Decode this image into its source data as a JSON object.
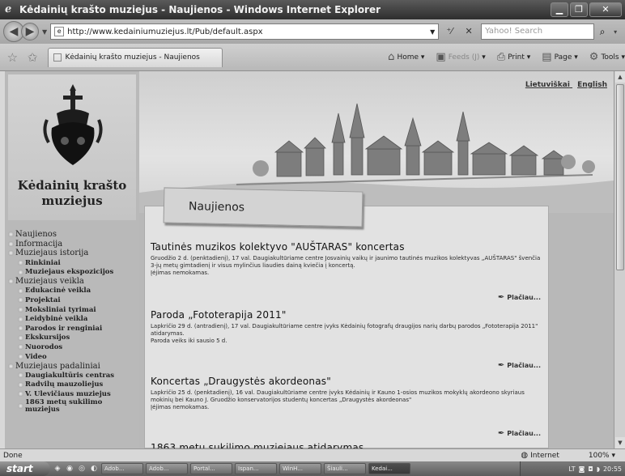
{
  "window": {
    "title": "Kėdainių krašto muziejus - Naujienos - Windows Internet Explorer"
  },
  "addressbar": {
    "url": "http://www.kedainiumuziejus.lt/Pub/default.aspx",
    "search_placeholder": "Yahoo! Search"
  },
  "commandbar": {
    "tab_title": "Kėdainių krašto muziejus - Naujienos",
    "home": "Home",
    "feeds": "Feeds (J)",
    "print": "Print",
    "page": "Page",
    "tools": "Tools"
  },
  "site": {
    "title": "Kėdainių krašto muziejus",
    "lang_lt": "Lietuviškai",
    "lang_en": "English",
    "section_heading": "Naujienos"
  },
  "menu": [
    {
      "label": "Naujienos",
      "sub": false
    },
    {
      "label": "Informacija",
      "sub": false
    },
    {
      "label": "Muziejaus istorija",
      "sub": false
    },
    {
      "label": "Rinkiniai",
      "sub": true
    },
    {
      "label": "Muziejaus ekspozicijos",
      "sub": true
    },
    {
      "label": "Muziejaus veikla",
      "sub": false
    },
    {
      "label": "Edukacinė veikla",
      "sub": true
    },
    {
      "label": "Projektai",
      "sub": true
    },
    {
      "label": "Moksliniai tyrimai",
      "sub": true
    },
    {
      "label": "Leidybinė veikla",
      "sub": true
    },
    {
      "label": "Parodos ir renginiai",
      "sub": true
    },
    {
      "label": "Ekskursijos",
      "sub": true
    },
    {
      "label": "Nuorodos",
      "sub": true
    },
    {
      "label": "Video",
      "sub": true
    },
    {
      "label": "Muziejaus padaliniai",
      "sub": false
    },
    {
      "label": "Daugiakultūris centras",
      "sub": true
    },
    {
      "label": "Radvilų mauzoliejus",
      "sub": true
    },
    {
      "label": "V. Ulevičiaus muziejus",
      "sub": true
    },
    {
      "label": "1863 metų sukilimo muziejus",
      "sub": true
    }
  ],
  "news": [
    {
      "title": "Tautinės muzikos kolektyvo \"AUŠTARAS\" koncertas",
      "body": "Gruodžio 2 d. (penktadienį), 17 val. Daugiakultūriame centre Josvainių vaikų ir jaunimo tautinės muzikos kolektyvas „AUŠTARAS\" švenčia 3-jų metų gimtadienį ir visus mylinčius liaudies dainą kviečia į koncertą.",
      "note": "Įėjimas nemokamas.",
      "more": "Plačiau..."
    },
    {
      "title": "Paroda „Fototerapija 2011\"",
      "body": "Lapkričio 29 d. (antradienį), 17 val. Daugiakultūriame centre įvyks Kėdainių fotografų draugijos narių darbų parodos „Fototerapija 2011\" atidarymas.",
      "note": "Paroda veiks iki sausio 5 d.",
      "more": "Plačiau..."
    },
    {
      "title": "Koncertas „Draugystės akordeonas\"",
      "body": "Lapkričio 25 d. (penktadienį), 16 val. Daugiakultūriame centre įvyks Kėdainių ir Kauno 1-osios muzikos mokyklų akordeono skyriaus mokinių bei Kauno J. Gruodžio konservatorijos studentų koncertas „Draugystės akordeonas\"",
      "note": "Įėjimas nemokamas.",
      "more": "Plačiau..."
    },
    {
      "title": "1863 metų sukilimo muziejaus atidarymas",
      "body": "",
      "note": "",
      "more": ""
    }
  ],
  "statusbar": {
    "status": "Done",
    "zone": "Internet",
    "zoom": "100%"
  },
  "taskbar": {
    "start": "start",
    "buttons": [
      "Adob...",
      "Adob...",
      "Portal...",
      "Ispan...",
      "WinH...",
      "Šiauli...",
      "Kedai..."
    ],
    "lang": "LT",
    "clock": "20:55"
  },
  "colors": {
    "titlebar": "#3a3a3a",
    "page_bg": "#b8b8b8",
    "content_bg": "#e2e2e2"
  }
}
